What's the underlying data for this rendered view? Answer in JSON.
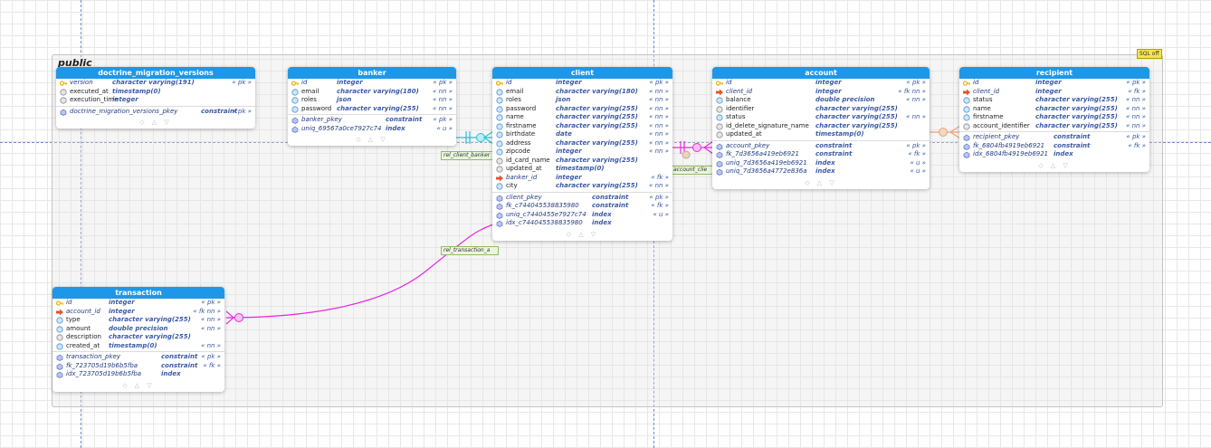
{
  "schema": {
    "name": "public",
    "sql_badge": "SQL off"
  },
  "relations": {
    "rel_client_banker": "rel_client_banker",
    "rel_transaction": "rel_transaction_a",
    "account_client": "account_clie"
  },
  "colors": {
    "header": "#1e97e8",
    "pk_key": "#e8b20c",
    "fk_arrow": "#e8542c",
    "unique_link": "#26c2d6",
    "magenta_link": "#e62ae0",
    "orange_link": "#e8a57a"
  },
  "tables": [
    {
      "id": "doctrine_migration_versions",
      "title": "doctrine_migration_versions",
      "columns": [
        {
          "icon": "pk",
          "name": "version",
          "type": "character varying(191)",
          "flags": "« pk »"
        },
        {
          "icon": "null",
          "name": "executed_at",
          "type": "timestamp(0)",
          "flags": ""
        },
        {
          "icon": "null",
          "name": "execution_time",
          "type": "integer",
          "flags": ""
        }
      ],
      "constraints": [
        {
          "name": "doctrine_migration_versions_pkey",
          "type": "constraint",
          "flags": "« pk »"
        }
      ]
    },
    {
      "id": "banker",
      "title": "banker",
      "columns": [
        {
          "icon": "pk",
          "name": "id",
          "type": "integer",
          "flags": "« pk »"
        },
        {
          "icon": "nn",
          "name": "email",
          "type": "character varying(180)",
          "flags": "« nn »"
        },
        {
          "icon": "nn",
          "name": "roles",
          "type": "json",
          "flags": "« nn »"
        },
        {
          "icon": "nn",
          "name": "password",
          "type": "character varying(255)",
          "flags": "« nn »"
        }
      ],
      "constraints": [
        {
          "name": "banker_pkey",
          "type": "constraint",
          "flags": "« pk »"
        },
        {
          "name": "uniq_69567a0ce7927c74",
          "type": "index",
          "flags": "« u »"
        }
      ]
    },
    {
      "id": "client",
      "title": "client",
      "columns": [
        {
          "icon": "pk",
          "name": "id",
          "type": "integer",
          "flags": "« pk »"
        },
        {
          "icon": "nn",
          "name": "email",
          "type": "character varying(180)",
          "flags": "« nn »"
        },
        {
          "icon": "nn",
          "name": "roles",
          "type": "json",
          "flags": "« nn »"
        },
        {
          "icon": "nn",
          "name": "password",
          "type": "character varying(255)",
          "flags": "« nn »"
        },
        {
          "icon": "nn",
          "name": "name",
          "type": "character varying(255)",
          "flags": "« nn »"
        },
        {
          "icon": "nn",
          "name": "firstname",
          "type": "character varying(255)",
          "flags": "« nn »"
        },
        {
          "icon": "nn",
          "name": "birthdate",
          "type": "date",
          "flags": "« nn »"
        },
        {
          "icon": "nn",
          "name": "address",
          "type": "character varying(255)",
          "flags": "« nn »"
        },
        {
          "icon": "nn",
          "name": "zipcode",
          "type": "integer",
          "flags": "« nn »"
        },
        {
          "icon": "null",
          "name": "id_card_name",
          "type": "character varying(255)",
          "flags": ""
        },
        {
          "icon": "null",
          "name": "updated_at",
          "type": "timestamp(0)",
          "flags": ""
        },
        {
          "icon": "fk",
          "name": "banker_id",
          "type": "integer",
          "flags": "« fk »"
        },
        {
          "icon": "nn",
          "name": "city",
          "type": "character varying(255)",
          "flags": "« nn »"
        }
      ],
      "constraints": [
        {
          "name": "client_pkey",
          "type": "constraint",
          "flags": "« pk »"
        },
        {
          "name": "fk_c744045538835980",
          "type": "constraint",
          "flags": "« fk »"
        },
        {
          "name": "uniq_c7440455e7927c74",
          "type": "index",
          "flags": "« u »"
        },
        {
          "name": "idx_c744045538835980",
          "type": "index",
          "flags": ""
        }
      ]
    },
    {
      "id": "account",
      "title": "account",
      "columns": [
        {
          "icon": "pk",
          "name": "id",
          "type": "integer",
          "flags": "« pk »"
        },
        {
          "icon": "fk",
          "name": "client_id",
          "type": "integer",
          "flags": "« fk nn »"
        },
        {
          "icon": "nn",
          "name": "balance",
          "type": "double precision",
          "flags": "« nn »"
        },
        {
          "icon": "null",
          "name": "identifier",
          "type": "character varying(255)",
          "flags": ""
        },
        {
          "icon": "nn",
          "name": "status",
          "type": "character varying(255)",
          "flags": "« nn »"
        },
        {
          "icon": "null",
          "name": "id_delete_signature_name",
          "type": "character varying(255)",
          "flags": ""
        },
        {
          "icon": "null",
          "name": "updated_at",
          "type": "timestamp(0)",
          "flags": ""
        }
      ],
      "constraints": [
        {
          "name": "account_pkey",
          "type": "constraint",
          "flags": "« pk »"
        },
        {
          "name": "fk_7d3656a419eb6921",
          "type": "constraint",
          "flags": "« fk »"
        },
        {
          "name": "uniq_7d3656a419eb6921",
          "type": "index",
          "flags": "« u »"
        },
        {
          "name": "uniq_7d3656a4772e836a",
          "type": "index",
          "flags": "« u »"
        }
      ]
    },
    {
      "id": "recipient",
      "title": "recipient",
      "columns": [
        {
          "icon": "pk",
          "name": "id",
          "type": "integer",
          "flags": "« pk »"
        },
        {
          "icon": "fk",
          "name": "client_id",
          "type": "integer",
          "flags": "« fk »"
        },
        {
          "icon": "nn",
          "name": "status",
          "type": "character varying(255)",
          "flags": "« nn »"
        },
        {
          "icon": "nn",
          "name": "name",
          "type": "character varying(255)",
          "flags": "« nn »"
        },
        {
          "icon": "nn",
          "name": "firstname",
          "type": "character varying(255)",
          "flags": "« nn »"
        },
        {
          "icon": "null",
          "name": "account_identifier",
          "type": "character varying(255)",
          "flags": "« nn »"
        }
      ],
      "constraints": [
        {
          "name": "recipient_pkey",
          "type": "constraint",
          "flags": "« pk »"
        },
        {
          "name": "fk_6804fb4919eb6921",
          "type": "constraint",
          "flags": "« fk »"
        },
        {
          "name": "idx_6804fb4919eb6921",
          "type": "index",
          "flags": ""
        }
      ]
    },
    {
      "id": "transaction",
      "title": "transaction",
      "columns": [
        {
          "icon": "pk",
          "name": "id",
          "type": "integer",
          "flags": "« pk »"
        },
        {
          "icon": "fk",
          "name": "account_id",
          "type": "integer",
          "flags": "« fk nn »"
        },
        {
          "icon": "nn",
          "name": "type",
          "type": "character varying(255)",
          "flags": "« nn »"
        },
        {
          "icon": "nn",
          "name": "amount",
          "type": "double precision",
          "flags": "« nn »"
        },
        {
          "icon": "null",
          "name": "description",
          "type": "character varying(255)",
          "flags": ""
        },
        {
          "icon": "nn",
          "name": "created_at",
          "type": "timestamp(0)",
          "flags": "« nn »"
        }
      ],
      "constraints": [
        {
          "name": "transaction_pkey",
          "type": "constraint",
          "flags": "« pk »"
        },
        {
          "name": "fk_723705d19b6b5fba",
          "type": "constraint",
          "flags": "« fk »"
        },
        {
          "name": "idx_723705d19b6b5fba",
          "type": "index",
          "flags": ""
        }
      ]
    }
  ]
}
